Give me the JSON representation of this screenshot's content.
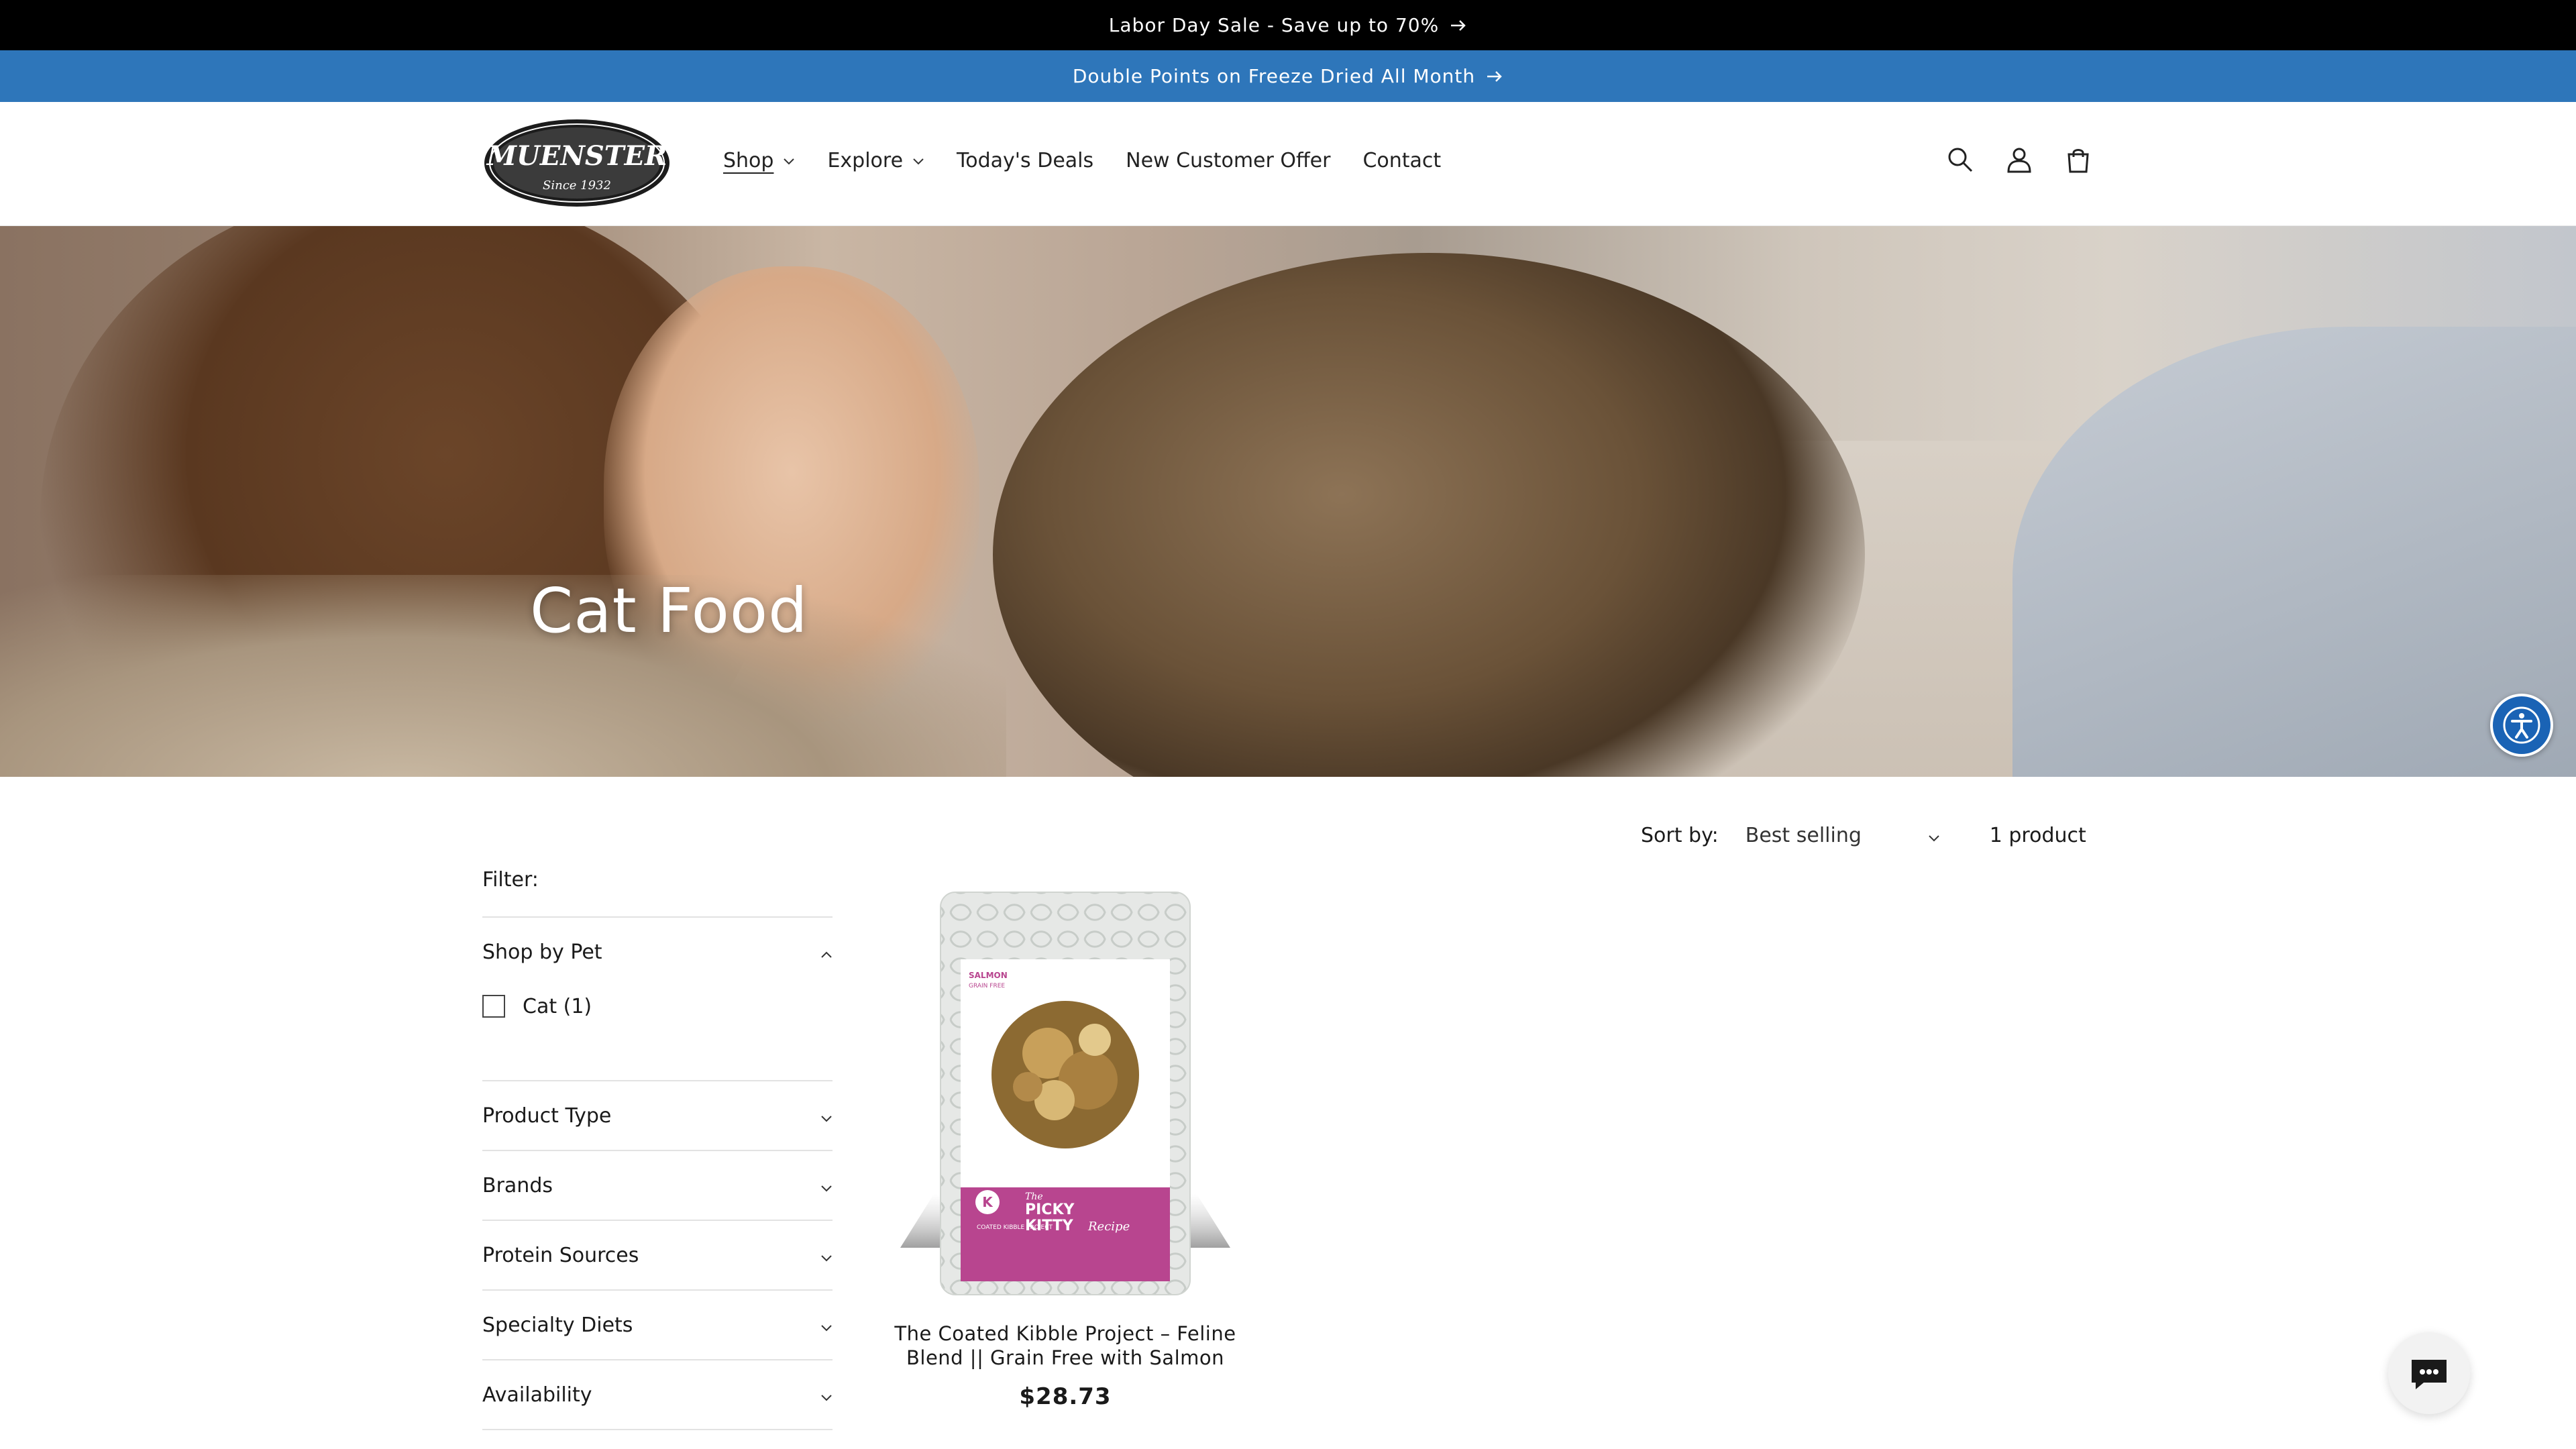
{
  "announcements": {
    "primary": "Labor Day Sale - Save up to 70%",
    "secondary": "Double Points on Freeze Dried All Month"
  },
  "logo": {
    "brand": "MUENSTER",
    "tagline": "Since 1932"
  },
  "nav": {
    "items": [
      {
        "label": "Shop",
        "dropdown": true,
        "active": true
      },
      {
        "label": "Explore",
        "dropdown": true
      },
      {
        "label": "Today's Deals"
      },
      {
        "label": "New Customer Offer"
      },
      {
        "label": "Contact"
      }
    ]
  },
  "header_icons": [
    "search-icon",
    "account-icon",
    "cart-icon"
  ],
  "hero": {
    "title": "Cat Food"
  },
  "filters": {
    "title": "Filter:",
    "groups": [
      {
        "label": "Shop by Pet",
        "expanded": true,
        "options": [
          {
            "label": "Cat (1)",
            "checked": false
          }
        ]
      },
      {
        "label": "Product Type",
        "expanded": false
      },
      {
        "label": "Brands",
        "expanded": false
      },
      {
        "label": "Protein Sources",
        "expanded": false
      },
      {
        "label": "Specialty Diets",
        "expanded": false
      },
      {
        "label": "Availability",
        "expanded": false
      }
    ]
  },
  "sort": {
    "label": "Sort by:",
    "value": "Best selling",
    "count": "1 product"
  },
  "products": [
    {
      "name": "The Coated Kibble Project – Feline Blend || Grain Free with Salmon",
      "price": "$28.73",
      "package": {
        "flavor": "SALMON",
        "flavor_sub": "GRAIN FREE",
        "line1": "The",
        "line2": "PICKY",
        "line3": "KITTY",
        "line4": "Recipe",
        "brand_letter": "K",
        "brand_line": "COATED KIBBLE PROJECT"
      }
    }
  ],
  "colors": {
    "announcement_bg": "#000000",
    "secondary_bg": "#2e76ba",
    "accessibility_button": "#1a63b5",
    "package_pink": "#b8458f"
  }
}
